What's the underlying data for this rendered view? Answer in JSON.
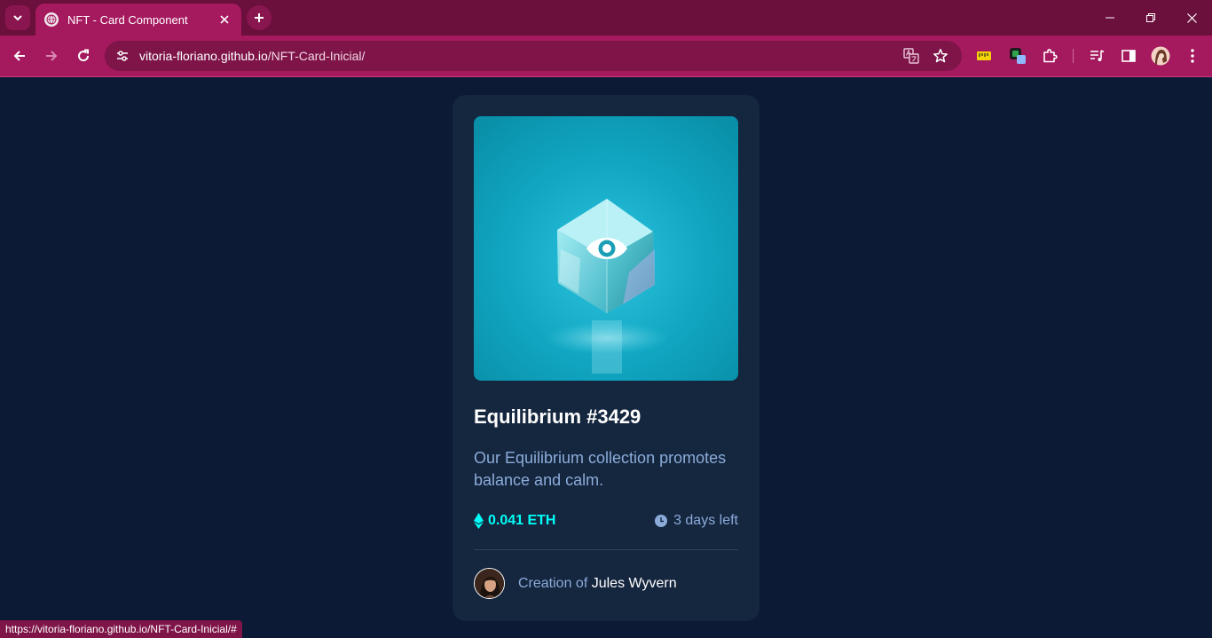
{
  "browser": {
    "tab": {
      "title": "NFT - Card Component"
    },
    "url": {
      "host": "vitoria-floriano.github.io",
      "path": "/NFT-Card-Inicial/"
    },
    "status_url": "https://vitoria-floriano.github.io/NFT-Card-Inicial/#",
    "icons": {
      "tab_search": "chevron-down-icon",
      "close": "close-icon",
      "new_tab": "plus-icon",
      "back": "back-arrow-icon",
      "forward": "forward-arrow-icon",
      "reload": "reload-icon",
      "site_info": "tune-icon",
      "translate": "translate-icon",
      "bookmark": "star-icon",
      "extensions": "puzzle-icon",
      "media": "media-control-icon",
      "side_panel": "side-panel-icon",
      "profile": "profile-avatar",
      "menu": "kebab-menu-icon"
    }
  },
  "card": {
    "title": "Equilibrium #3429",
    "description": "Our Equilibrium collection promotes balance and calm.",
    "price": "0.041 ETH",
    "time_left": "3 days left",
    "creator_prefix": "Creation of ",
    "creator_name": "Jules Wyvern"
  },
  "colors": {
    "page_bg": "#0d1a36",
    "card_bg": "#15263f",
    "cyan": "#00fff8",
    "soft_blue": "#8bacd9",
    "browser_accent": "#a5195e"
  }
}
